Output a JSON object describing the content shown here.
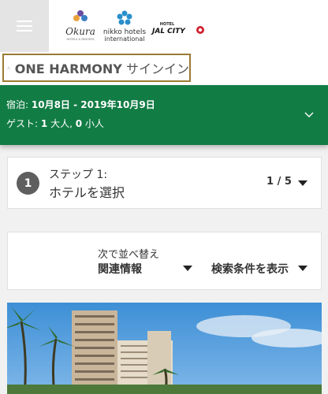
{
  "header": {
    "menu_icon": "hamburger-menu-icon",
    "brands": [
      {
        "name": "Okura",
        "tagline": "HOTELS & RESORTS",
        "icon": "okura-logo-icon"
      },
      {
        "name": "nikko hotels",
        "tagline": "international",
        "icon": "nikko-logo-icon"
      },
      {
        "name": "JAL CITY",
        "tagline": "HOTEL",
        "icon": "jalcity-logo-icon"
      }
    ]
  },
  "signin": {
    "program": "ONE HARMONY",
    "action": "サインイン",
    "icon": "user-icon",
    "border_color": "#9a7b35"
  },
  "stay": {
    "dates_label": "宿泊:",
    "dates_value": "10月8日 - 2019年10月9日",
    "guests_label": "ゲスト:",
    "adults_count": "1",
    "adults_unit": "大人,",
    "children_count": "0",
    "children_unit": "小人",
    "background": "#127c45"
  },
  "step": {
    "number": "1",
    "title": "ステップ 1:",
    "subtitle": "ホテルを選択",
    "progress": "1 / 5"
  },
  "sort": {
    "label": "次で並べ替え",
    "value": "関連情報",
    "filter_label": "検索条件を表示"
  },
  "hero": {
    "description": "hotel-photo"
  }
}
